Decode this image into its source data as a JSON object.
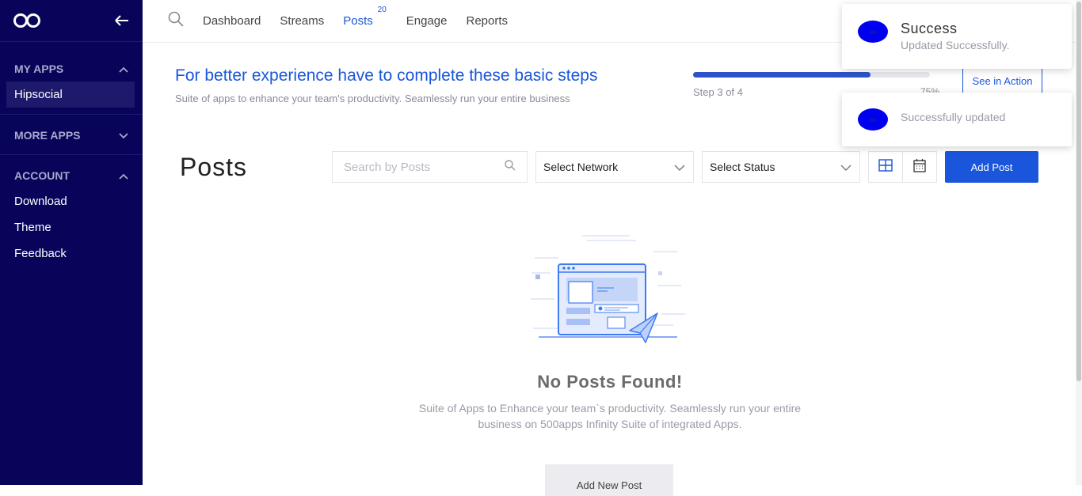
{
  "sidebar": {
    "sections": [
      {
        "label": "MY APPS",
        "items": [
          "Hipsocial"
        ]
      },
      {
        "label": "MORE APPS",
        "items": []
      },
      {
        "label": "ACCOUNT",
        "items": [
          "Download",
          "Theme",
          "Feedback"
        ]
      }
    ]
  },
  "topnav": {
    "items": [
      "Dashboard",
      "Streams",
      "Posts",
      "Engage",
      "Reports"
    ],
    "posts_badge": "20"
  },
  "banner": {
    "title": "For better experience have to complete these basic steps",
    "subtitle": "Suite of apps to enhance your team's productivity. Seamlessly run your entire business",
    "step_text": "Step 3 of 4",
    "progress_percent": 75,
    "progress_label": "75%",
    "see_in_action": "See in Action"
  },
  "posts": {
    "title": "Posts",
    "search_placeholder": "Search by Posts",
    "select_network": "Select Network",
    "select_status": "Select Status",
    "add_post": "Add Post"
  },
  "empty_state": {
    "title": "No Posts Found!",
    "description": "Suite of Apps to Enhance your team`s productivity. Seamlessly run your entire business on 500apps Infinity Suite of integrated Apps.",
    "button": "Add New Post"
  },
  "toasts": [
    {
      "title": "Success",
      "message": "Updated Successfully."
    },
    {
      "message": "Successfully updated"
    }
  ],
  "colors": {
    "sidebar": "#07045a",
    "accent": "#1a56db",
    "toast_icon": "#0000ee"
  }
}
